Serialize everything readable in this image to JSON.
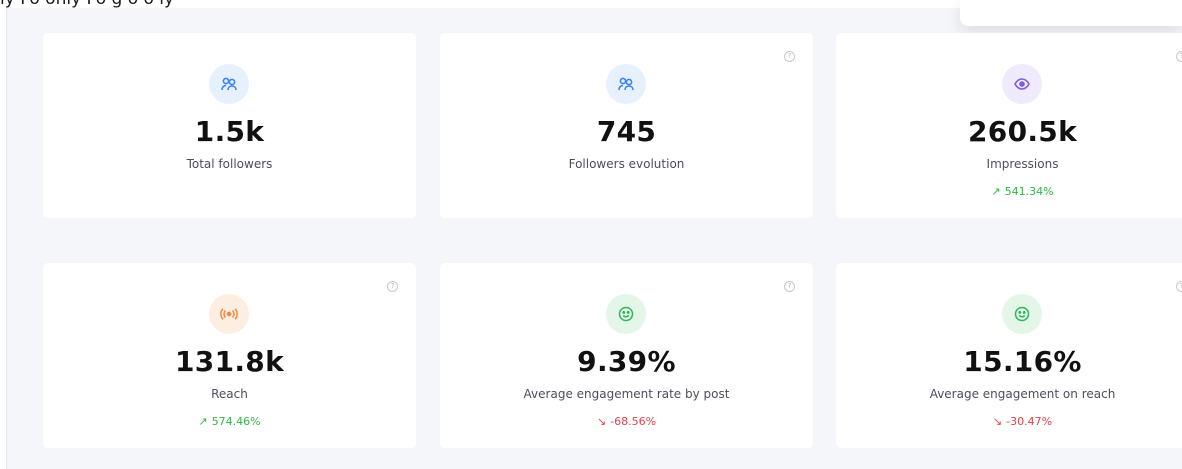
{
  "header": {
    "partial_text": "ly Fo    only Fo    g o    o ly"
  },
  "colors": {
    "up": "#37b34a",
    "down": "#e2424a",
    "background": "#f4f6fa"
  },
  "cards": [
    {
      "value": "1.5k",
      "label": "Total followers",
      "icon": "users-icon",
      "change": ""
    },
    {
      "value": "745",
      "label": "Followers evolution",
      "icon": "users-icon",
      "change": ""
    },
    {
      "value": "260.5k",
      "label": "Impressions",
      "icon": "eye-icon",
      "change": "541.34%"
    },
    {
      "value": "131.8k",
      "label": "Reach",
      "icon": "broadcast-icon",
      "change": "574.46%"
    },
    {
      "value": "9.39%",
      "label": "Average engagement rate by post",
      "icon": "smile-icon",
      "change": "-68.56%"
    },
    {
      "value": "15.16%",
      "label": "Average engagement on reach",
      "icon": "smile-icon",
      "change": "-30.47%"
    }
  ],
  "help": {
    "glyph": "?"
  }
}
